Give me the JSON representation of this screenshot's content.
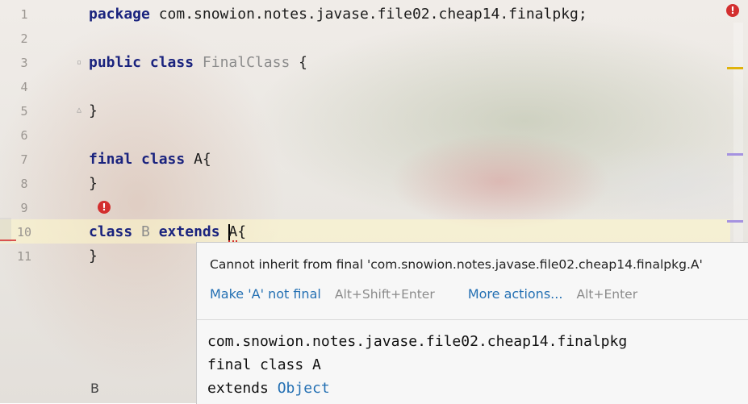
{
  "editor": {
    "line_numbers": [
      "1",
      "2",
      "3",
      "4",
      "5",
      "6",
      "7",
      "8",
      "9",
      "10",
      "11"
    ],
    "lines": {
      "l1_kw": "package",
      "l1_rest": " com.snowion.notes.javase.file02.cheap14.finalpkg;",
      "l3_kw1": "public",
      "l3_kw2": "class",
      "l3_name": "FinalClass",
      "l3_brace": " {",
      "l5": "}",
      "l7_kw1": "final",
      "l7_kw2": "class",
      "l7_name": "A{",
      "l8": "}",
      "l10_kw1": "class",
      "l10_name": "B",
      "l10_kw2": "extends",
      "l10_target": "A",
      "l10_brace": "{",
      "l11": "}"
    },
    "bottom_label": "B",
    "colors": {
      "keyword": "#1a237e",
      "error": "#d32f2f",
      "link": "#2470b3",
      "highlight": "#fff8c8"
    }
  },
  "popup": {
    "message": "Cannot inherit from final 'com.snowion.notes.javase.file02.cheap14.finalpkg.A'",
    "action_primary": "Make 'A' not final",
    "action_primary_shortcut": "Alt+Shift+Enter",
    "action_more": "More actions...",
    "action_more_shortcut": "Alt+Enter",
    "doc": {
      "package": "com.snowion.notes.javase.file02.cheap14.finalpkg",
      "declaration": "final class A",
      "extends_kw": "extends ",
      "extends_type": "Object"
    }
  },
  "icons": {
    "error_bulb": "error-bulb-icon",
    "inspection_error": "inspection-error-icon"
  }
}
